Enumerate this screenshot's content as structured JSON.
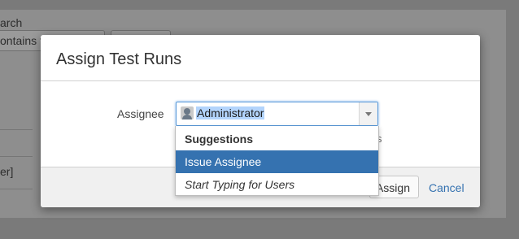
{
  "background": {
    "search_label_fragment": "arch",
    "search_input_fragment": "ontains t",
    "bracket_fragment": "er]"
  },
  "dialog": {
    "title": "Assign Test Runs",
    "assignee_label": "Assignee",
    "assignee_value": "Administrator",
    "hint_fragment": "s",
    "assign_button": "Assign",
    "cancel_link": "Cancel"
  },
  "dropdown": {
    "header": "Suggestions",
    "items": [
      {
        "label": "Issue Assignee"
      },
      {
        "label": "Start Typing for Users"
      }
    ]
  },
  "colors": {
    "highlight": "#3572b0",
    "link": "#3572b0",
    "selection": "#b3d4fc"
  },
  "icons": [
    "user-avatar-icon",
    "dropdown-arrow-icon"
  ]
}
